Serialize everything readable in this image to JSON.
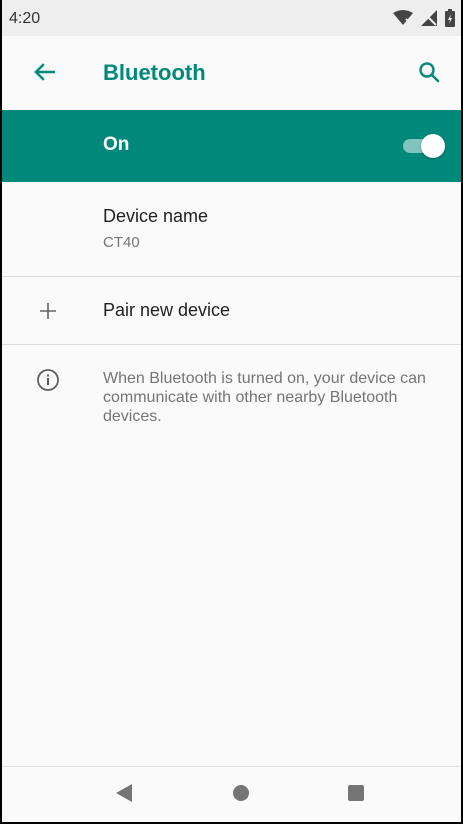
{
  "status_bar": {
    "time": "4:20",
    "icons": [
      "wifi-off-icon",
      "signal-off-icon",
      "battery-icon"
    ]
  },
  "app_bar": {
    "title": "Bluetooth",
    "back_icon": "arrow-back-icon",
    "search_icon": "search-icon"
  },
  "master_switch": {
    "label": "On",
    "state": "on"
  },
  "settings": {
    "device_name": {
      "title": "Device name",
      "value": "CT40"
    },
    "pair_new_device": {
      "title": "Pair new device",
      "icon": "plus-icon"
    }
  },
  "info": {
    "icon": "info-icon",
    "text": "When Bluetooth is turned on, your device can communicate with other nearby Bluetooth devices."
  },
  "navigation": {
    "back": "nav-back-icon",
    "home": "nav-home-icon",
    "recents": "nav-recents-icon"
  },
  "colors": {
    "accent": "#00897b",
    "text_primary": "#212121",
    "text_secondary": "#757575"
  }
}
